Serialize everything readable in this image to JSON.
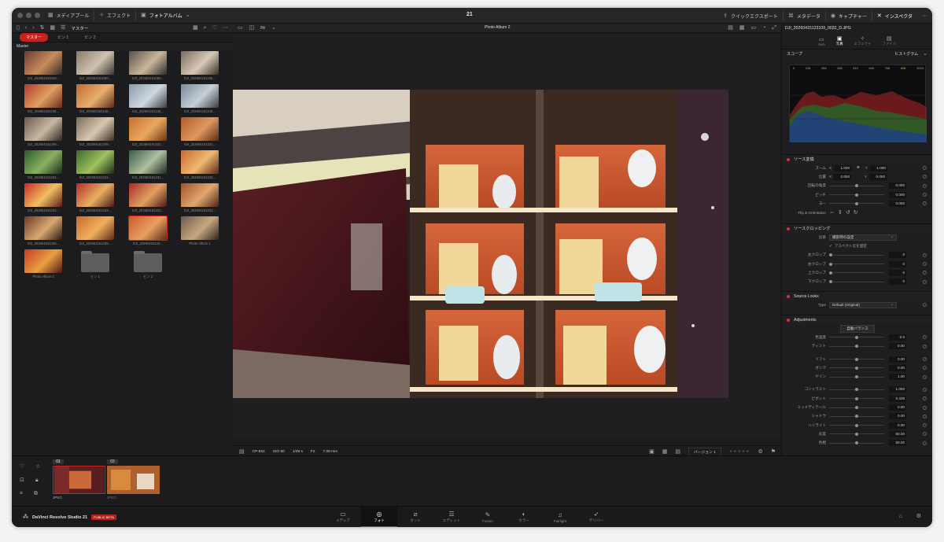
{
  "title": {
    "timeline_number": "21"
  },
  "topbar": {
    "media_pool": "メディアプール",
    "effects": "エフェクト",
    "photo_album": "フォトアルバム",
    "quick_export": "クイックエクスポート",
    "metadata": "メタデータ",
    "capture": "キャプチャー",
    "inspector": "インスペクタ"
  },
  "mediapool": {
    "breadcrumb": "マスター",
    "tabs": [
      "マスター",
      "ビン 1",
      "ビン 2"
    ],
    "section": "Master",
    "items": [
      "DJI_202604151049...",
      "DJI_202604151050...",
      "DJI_202604151050...",
      "DJI_202604151105...",
      "DJI_202604151109...",
      "DJI_202604151140...",
      "DJI_202604151140...",
      "DJI_202604151140...",
      "DJI_202604151208...",
      "DJI_202604151208...",
      "DJI_202604151231...",
      "DJI_202604151231...",
      "DJI_202604151231...",
      "DJI_202604151231...",
      "DJI_202604151231...",
      "DJI_202604151232...",
      "DJI_202604151232...",
      "DJI_202604151233...",
      "DJI_202604151233...",
      "DJI_202604151233...",
      "DJI_202604151235...",
      "DJI_202604151235...",
      "DJI_20260415123...",
      "Photo Album 1",
      "Photo Album 2",
      "ビン 1",
      "ビン 2"
    ],
    "selected_index": 22
  },
  "viewer": {
    "fit": "Fit",
    "album": "Photo Album 2",
    "camera": "CP-841",
    "iso": "ISO 50",
    "shutter": "1/49 s",
    "fstop": "F2",
    "focal": "7.08 mm",
    "version": "バージョン 1"
  },
  "inspector": {
    "filename": "DJI_20260415123109_0032_D.JPG",
    "tabs": [
      "Web",
      "写真",
      "エフェクト",
      "ファイル"
    ],
    "scope_label": "スコープ",
    "scope_mode": "ヒストグラム",
    "hist_ticks": [
      "0",
      "128",
      "256",
      "384",
      "512",
      "640",
      "768",
      "896",
      "1023"
    ],
    "transform": {
      "header": "ソース変換",
      "zoom_label": "ズーム",
      "zoom_x": "1.000",
      "zoom_y": "1.000",
      "pos_label": "位置",
      "pos_x": "0.000",
      "pos_y": "0.000",
      "rotate_label": "回転の角度",
      "rotate": "0.000",
      "pitch_label": "ピッチ",
      "pitch": "0.000",
      "yaw_label": "ヨー",
      "yaw": "0.000",
      "flip_label": "Flip & Orientation"
    },
    "crop": {
      "header": "ソースクロッピング",
      "ratio_label": "比率",
      "ratio": "撮影時の設定",
      "lock": "アスペクト比を固定",
      "left_label": "左クロップ",
      "left": "0",
      "right_label": "右クロップ",
      "right": "0",
      "top_label": "上クロップ",
      "top": "0",
      "bottom_label": "下クロップ",
      "bottom": "0"
    },
    "looks": {
      "header": "Source Looks",
      "type_label": "Type",
      "type": "Default (Original)"
    },
    "adjust": {
      "header": "Adjustments",
      "auto": "自動バランス",
      "rows": [
        {
          "label": "色温度",
          "value": "0.0"
        },
        {
          "label": "ティント",
          "value": "0.00"
        },
        {
          "label": "リフト",
          "value": "0.00"
        },
        {
          "label": "ガンマ",
          "value": "0.00"
        },
        {
          "label": "ゲイン",
          "value": "1.00"
        },
        {
          "label": "コントラスト",
          "value": "1.000"
        },
        {
          "label": "ピボット",
          "value": "0.435"
        },
        {
          "label": "ミッドディテール",
          "value": "0.00"
        },
        {
          "label": "シャドウ",
          "value": "0.00"
        },
        {
          "label": "ハイライト",
          "value": "0.00"
        },
        {
          "label": "彩度",
          "value": "50.00"
        },
        {
          "label": "色相",
          "value": "50.00"
        }
      ]
    }
  },
  "filmstrip": {
    "items": [
      {
        "index": "01",
        "format": "JPEG"
      },
      {
        "index": "02",
        "format": "JPEG"
      }
    ]
  },
  "bottom": {
    "app": "DaVinci Resolve Studio 21",
    "badge": "PUBLIC BETA",
    "nav": [
      "メディア",
      "フォト",
      "カット",
      "エディット",
      "Fusion",
      "カラー",
      "Fairlight",
      "デリバー"
    ],
    "active": 1
  },
  "colors": {
    "accent": "#c6231e",
    "bg": "#1c1c1e"
  }
}
